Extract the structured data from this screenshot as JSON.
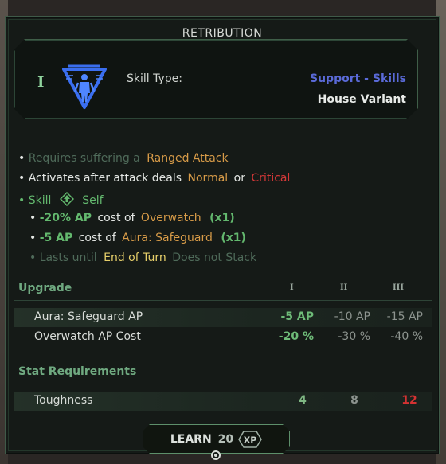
{
  "title": "RETRIBUTION",
  "skill": {
    "rank": "I",
    "type_label": "Skill Type:",
    "type_value": "Support - Skills",
    "variant": "House Variant"
  },
  "effects": {
    "line1": {
      "bullet": "•",
      "text": "Requires suffering a",
      "keyword": "Ranged Attack"
    },
    "line2": {
      "bullet": "•",
      "text": "Activates after attack deals",
      "normal": "Normal",
      "or": "or",
      "critical": "Critical"
    },
    "line3": {
      "bullet": "•",
      "skill": "Skill",
      "target": "Self"
    },
    "line4": {
      "bullet": "•",
      "amount": "-20% AP",
      "text": "cost of",
      "ability": "Overwatch",
      "mult": "(x1)"
    },
    "line5": {
      "bullet": "•",
      "amount": "-5 AP",
      "text": "cost of",
      "ability": "Aura: Safeguard",
      "mult": "(x1)"
    },
    "line6": {
      "bullet": "•",
      "text": "Lasts until",
      "until": "End of Turn",
      "stack": "Does not Stack"
    }
  },
  "upgrade": {
    "heading": "Upgrade",
    "ranks": [
      "I",
      "II",
      "III"
    ],
    "rows": [
      {
        "name": "Aura: Safeguard AP",
        "values": [
          "-5 AP",
          "-10 AP",
          "-15 AP"
        ]
      },
      {
        "name": "Overwatch AP Cost",
        "values": [
          "-20 %",
          "-30 %",
          "-40 %"
        ]
      }
    ]
  },
  "stats": {
    "heading": "Stat Requirements",
    "rows": [
      {
        "name": "Toughness",
        "values": [
          "4",
          "8",
          "12"
        ]
      }
    ]
  },
  "learn": {
    "label": "LEARN",
    "cost": "20",
    "unit": "XP"
  },
  "colors": {
    "accent_green": "#63b86e",
    "keyword_orange": "#d79b48",
    "critical_red": "#d43838",
    "type_blue": "#5a6ad8",
    "icon_blue": "#3a6ef0"
  }
}
